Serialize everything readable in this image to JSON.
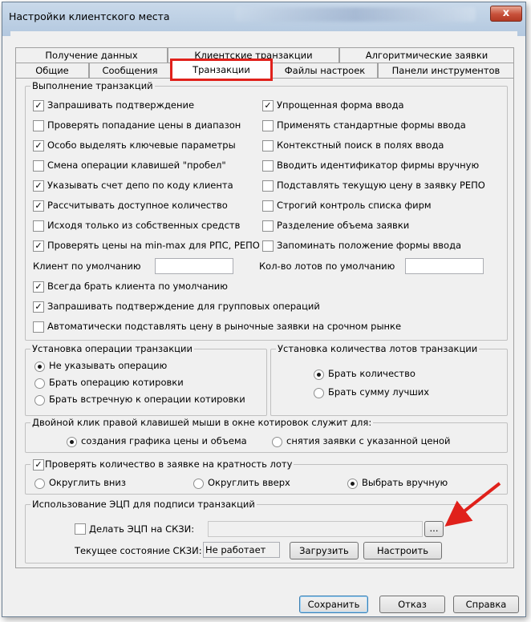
{
  "window": {
    "title": "Настройки клиентского места",
    "close_label": "x"
  },
  "tabs_row1": [
    "Получение данных",
    "Клиентские транзакции",
    "Алгоритмические заявки"
  ],
  "tabs_row2": [
    "Общие",
    "Сообщения",
    "Транзакции",
    "Файлы настроек",
    "Панели инструментов"
  ],
  "exec": {
    "title": "Выполнение транзакций",
    "left": [
      {
        "label": "Запрашивать подтверждение",
        "checked": true
      },
      {
        "label": "Проверять попадание цены в диапазон",
        "checked": false
      },
      {
        "label": "Особо выделять ключевые параметры",
        "checked": true
      },
      {
        "label": "Смена операции клавишей \"пробел\"",
        "checked": false
      },
      {
        "label": "Указывать счет депо по коду клиента",
        "checked": true
      },
      {
        "label": "Рассчитывать доступное количество",
        "checked": true
      },
      {
        "label": "Исходя только из собственных средств",
        "checked": false
      },
      {
        "label": "Проверять цены на min-max для РПС, РЕПО",
        "checked": true
      }
    ],
    "right": [
      {
        "label": "Упрощенная форма ввода",
        "checked": true
      },
      {
        "label": "Применять стандартные формы ввода",
        "checked": false
      },
      {
        "label": "Контекстный поиск в полях ввода",
        "checked": false
      },
      {
        "label": "Вводить идентификатор фирмы вручную",
        "checked": false
      },
      {
        "label": "Подставлять текущую цену в заявку РЕПО",
        "checked": false
      },
      {
        "label": "Строгий контроль списка фирм",
        "checked": false
      },
      {
        "label": "Разделение объема заявки",
        "checked": false
      },
      {
        "label": "Запоминать положение формы ввода",
        "checked": false
      }
    ],
    "client_label": "Клиент по умолчанию",
    "client_value": "",
    "lots_label": "Кол-во лотов по умолчанию",
    "lots_value": "",
    "bottom": [
      {
        "label": "Всегда брать клиента по умолчанию",
        "checked": true
      },
      {
        "label": "Запрашивать подтверждение для групповых операций",
        "checked": true
      },
      {
        "label": "Автоматически подставлять цену в рыночные заявки на срочном рынке",
        "checked": false
      }
    ]
  },
  "op": {
    "title": "Установка операции транзакции",
    "options": [
      "Не указывать операцию",
      "Брать операцию котировки",
      "Брать встречную к операции котировки"
    ],
    "selected": 0
  },
  "lots": {
    "title": "Установка количества лотов транзакции",
    "options": [
      "Брать количество",
      "Брать сумму лучших"
    ],
    "selected": 0
  },
  "dbl": {
    "title": "Двойной клик правой клавишей мыши в окне котировок служит для:",
    "options": [
      "создания графика цены и объема",
      "снятия заявки с указанной ценой"
    ],
    "selected": 0
  },
  "mult": {
    "check_label": "Проверять количество в заявке на кратность лоту",
    "checked": true,
    "options": [
      "Округлить вниз",
      "Округлить вверх",
      "Выбрать вручную"
    ],
    "selected": 2
  },
  "ecp": {
    "title": "Использование ЭЦП для подписи транзакций",
    "check_label": "Делать ЭЦП на СКЗИ:",
    "checked": false,
    "path_value": "",
    "browse_label": "...",
    "state_label": "Текущее состояние СКЗИ:",
    "state_value": "Не работает",
    "load_label": "Загрузить",
    "setup_label": "Настроить"
  },
  "footer": {
    "save": "Сохранить",
    "cancel": "Отказ",
    "help": "Справка"
  },
  "colors": {
    "highlight": "#e0211b"
  }
}
